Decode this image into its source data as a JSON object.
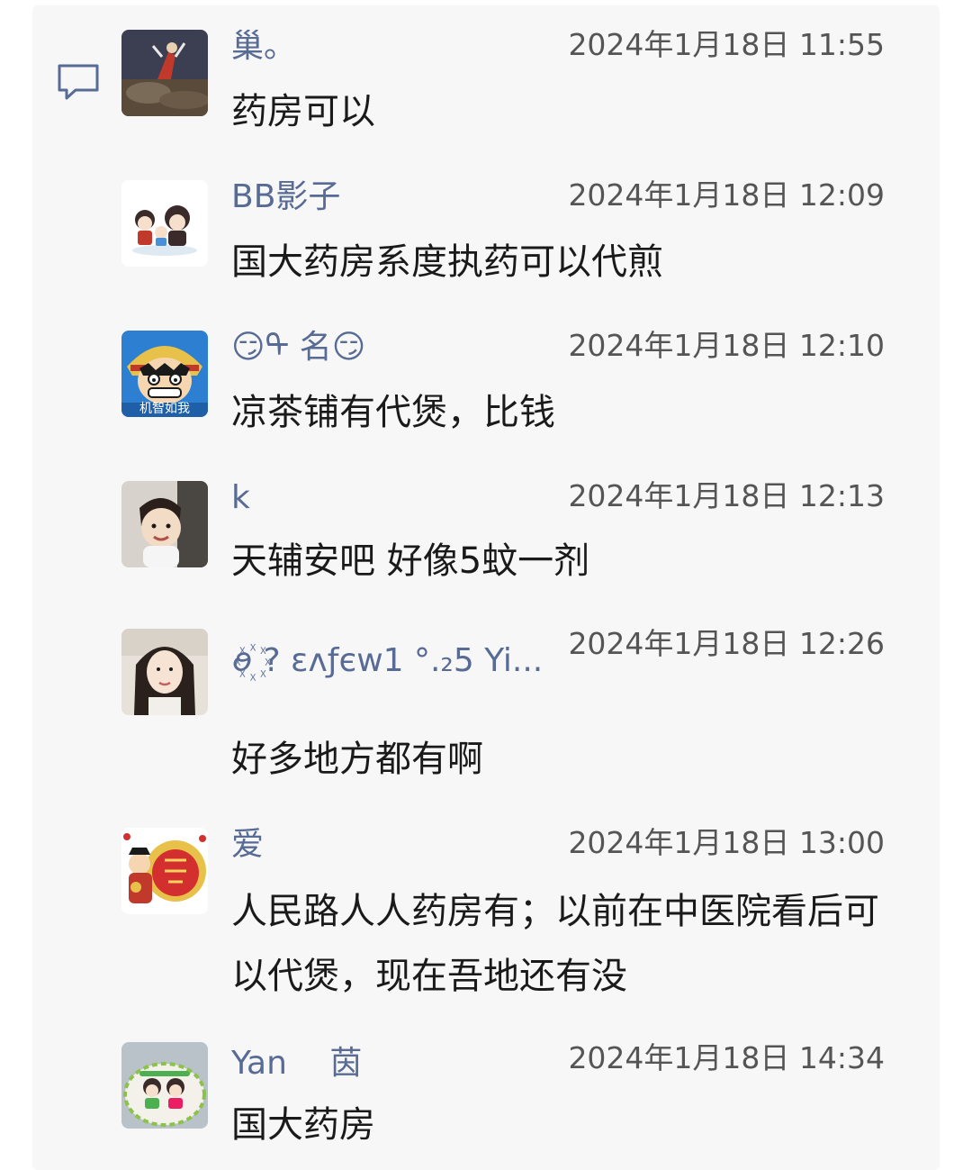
{
  "comments": [
    {
      "name": "巢。",
      "time": "2024年1月18日 11:55",
      "text": "药房可以",
      "avatar": "avatar-dark-scene"
    },
    {
      "name": "BB影子",
      "time": "2024年1月18日 12:09",
      "text": "国大药房系度执药可以代煎",
      "avatar": "avatar-cartoon-family"
    },
    {
      "name": "😏ᠲ 名😏",
      "time": "2024年1月18日 12:10",
      "text": "凉茶铺有代煲，比钱",
      "avatar": "avatar-anime-face",
      "avatar_caption": "机智如我"
    },
    {
      "name": "k",
      "time": "2024年1月18日 12:13",
      "text": "天辅安吧 好像5蚊一剂",
      "avatar": "avatar-baby-photo"
    },
    {
      "name": "ꪮ꙰ ? εᴧƒєw1 °.₂5 Yi...",
      "time": "2024年1月18日 12:26",
      "text": "好多地方都有啊",
      "avatar": "avatar-woman-photo"
    },
    {
      "name": "爱",
      "time": "2024年1月18日 13:00",
      "text": "人民路人人药房有；以前在中医院看后可以代煲，现在吾地还有没",
      "avatar": "avatar-festive-red"
    },
    {
      "name": "Yan　 茵",
      "time": "2024年1月18日 14:34",
      "text": "国大药房",
      "avatar": "avatar-cake-photo"
    }
  ],
  "colors": {
    "name": "#576b95",
    "time": "#555555",
    "text": "#1a1a1a",
    "panel": "#f7f7f7"
  },
  "icons": {
    "comment": "comment-bubble-icon"
  }
}
